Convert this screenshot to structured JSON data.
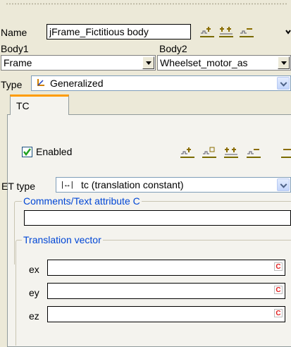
{
  "name_label": "Name",
  "name_value": "jFrame_Fictitious body",
  "body1_label": "Body1",
  "body2_label": "Body2",
  "body1_value": "Frame",
  "body2_value": "Wheelset_motor_as",
  "type_label": "Type",
  "type_value": "Generalized",
  "tab_label": "TC",
  "enabled_label": "Enabled",
  "enabled_checked": true,
  "et_type_label": "ET type",
  "et_type_value": "tc (translation constant)",
  "comments_label": "Comments/Text attribute C",
  "comments_value": "",
  "translation_label": "Translation vector",
  "vector_rows": [
    {
      "label": "ex",
      "value": "",
      "c": "C"
    },
    {
      "label": "ey",
      "value": "",
      "c": "C"
    },
    {
      "label": "ez",
      "value": "",
      "c": "C"
    }
  ],
  "colors": {
    "accent": "#0046d5",
    "check": "#21a121",
    "tab_top": "#ff9c00"
  }
}
